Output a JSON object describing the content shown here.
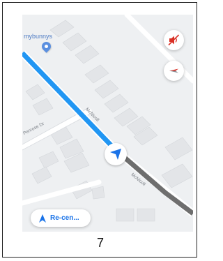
{
  "map": {
    "place_name": "mybunnys",
    "streets": {
      "penrose": "Penrose Dr",
      "route_upper": "McNicoll",
      "route_lower": "McNicoll"
    }
  },
  "buttons": {
    "mute_icon": "volume-off-icon",
    "compass_icon": "compass-icon",
    "recenter_label": "Re-cen..."
  },
  "colors": {
    "route": "#2196f3",
    "traveled": "#6e6e6e",
    "mute": "#d93025",
    "accent": "#1a73e8"
  },
  "page_number": "7"
}
